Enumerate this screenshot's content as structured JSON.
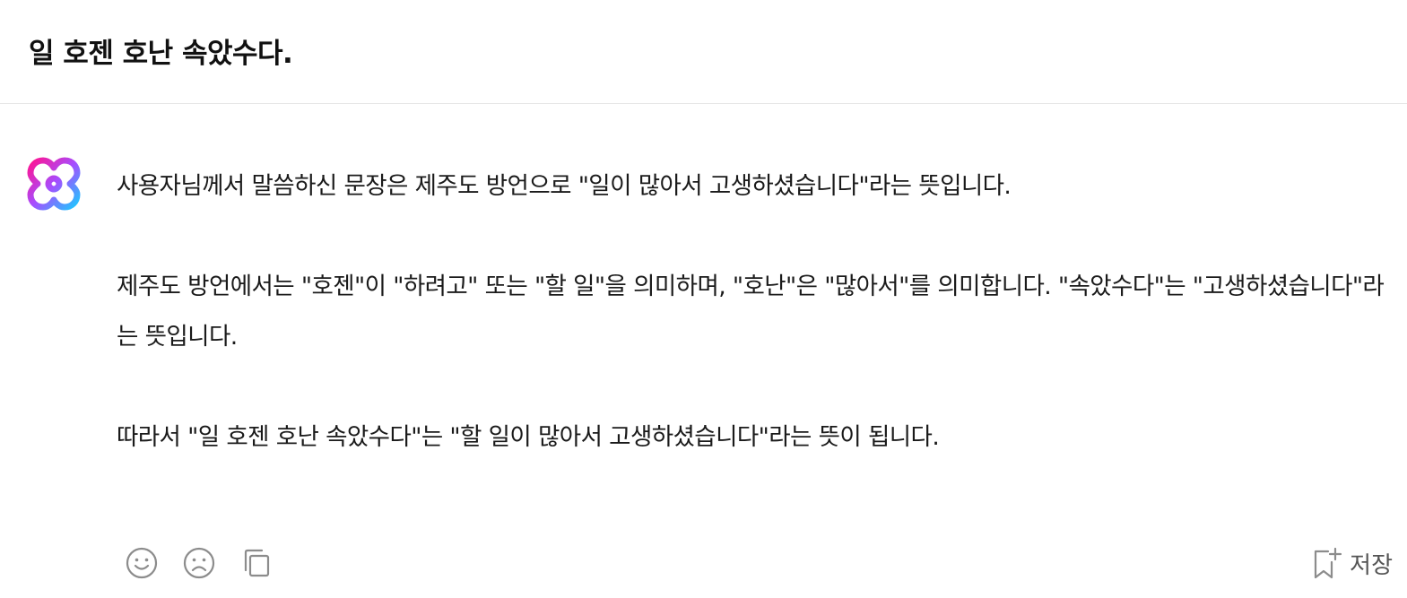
{
  "question": "일 호젠 호난 속았수다.",
  "answer": {
    "paragraphs": [
      "사용자님께서 말씀하신 문장은 제주도 방언으로 \"일이 많아서 고생하셨습니다\"라는 뜻입니다.",
      "제주도 방언에서는 \"호젠\"이 \"하려고\" 또는 \"할 일\"을 의미하며, \"호난\"은 \"많아서\"를 의미합니다. \"속았수다\"는 \"고생하셨습니다\"라는 뜻입니다.",
      "따라서 \"일 호젠 호난 속았수다\"는 \"할 일이 많아서 고생하셨습니다\"라는 뜻이 됩니다."
    ]
  },
  "actions": {
    "like_icon": "smile-icon",
    "dislike_icon": "frown-icon",
    "copy_icon": "copy-icon",
    "save_icon": "bookmark-add-icon",
    "save_label": "저장"
  },
  "colors": {
    "logo_gradient_start": "#ff1493",
    "logo_gradient_mid": "#a64dff",
    "logo_gradient_end": "#1ec8ff",
    "icon_gray": "#8c8c8c"
  }
}
